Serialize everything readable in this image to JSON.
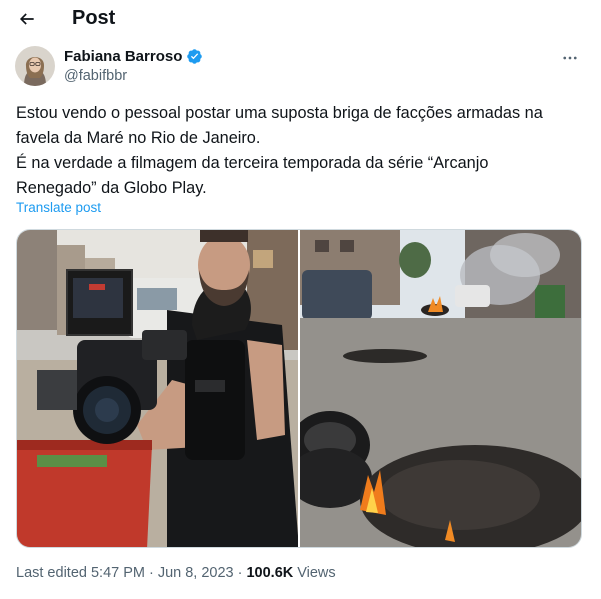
{
  "header": {
    "back_icon": "arrow-left-icon",
    "title": "Post"
  },
  "author": {
    "name": "Fabiana Barroso",
    "handle": "@fabifbbr",
    "verified": true,
    "verified_color": "#1d9bf0",
    "more_icon": "more-horizontal-icon"
  },
  "post": {
    "lines": [
      "Estou vendo o pessoal postar uma suposta briga de facções armadas na",
      "favela da Maré no Rio de Janeiro.",
      "É na verdade a filmagem da terceira temporada da série “Arcanjo",
      "Renegado” da Globo Play."
    ],
    "translate_label": "Translate post",
    "link_color": "#1d9bf0"
  },
  "media": {
    "photos": [
      {
        "name": "photo-cameraman"
      },
      {
        "name": "photo-burning-tire-street"
      }
    ]
  },
  "meta": {
    "edited": "Last edited 5:47 PM",
    "date": "Jun 8, 2023",
    "separator": "·",
    "views_count": "100.6K",
    "views_label": "Views"
  }
}
